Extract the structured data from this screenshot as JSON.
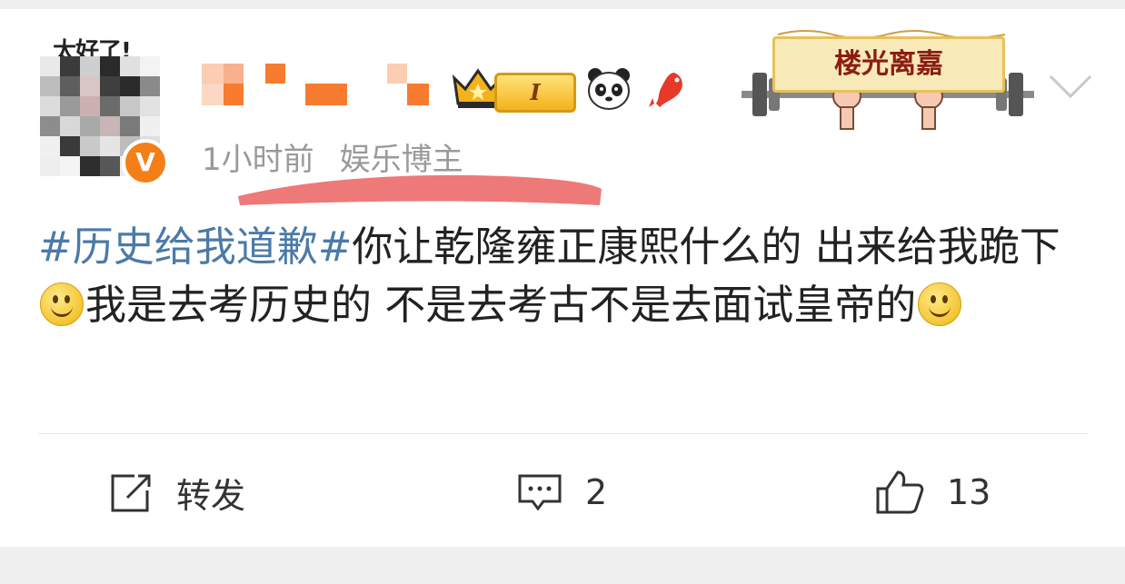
{
  "post": {
    "avatar_caption": "太好了!",
    "verified_badge": "V",
    "vip_level": "I",
    "banner_text": "楼光离嘉",
    "time": "1小时前",
    "author_tag": "娱乐博主",
    "text": {
      "hashtag": "#历史给我道歉#",
      "segment_1": "你让乾隆雍正康熙什么的 出来给我跪下",
      "segment_2": "我是去考历史的 不是去考古不是去面试皇帝的"
    }
  },
  "actions": {
    "repost_label": "转发",
    "comment_count": "2",
    "like_count": "13"
  },
  "icons": [
    "verified-icon",
    "vip-crown-icon",
    "panda-icon",
    "koi-icon",
    "chevron-down-icon",
    "smile-emoji-icon",
    "repost-icon",
    "comment-icon",
    "like-icon"
  ],
  "colors": {
    "hashtag": "#4b7aa8",
    "verified": "#f57f17",
    "highlight": "#ec6a6a",
    "meta_text": "#9a9a9a"
  }
}
